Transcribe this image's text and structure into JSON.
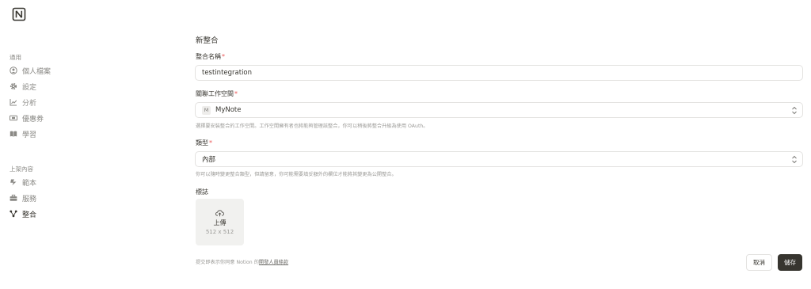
{
  "sidebar": {
    "general_title": "通用",
    "general_items": [
      {
        "label": "個人檔案",
        "icon": "user-circle-icon"
      },
      {
        "label": "設定",
        "icon": "gear-icon"
      },
      {
        "label": "分析",
        "icon": "chart-line-icon"
      },
      {
        "label": "優惠券",
        "icon": "ticket-icon"
      },
      {
        "label": "學習",
        "icon": "book-icon"
      }
    ],
    "listing_title": "上架內容",
    "listing_items": [
      {
        "label": "範本",
        "icon": "template-icon"
      },
      {
        "label": "服務",
        "icon": "briefcase-icon"
      },
      {
        "label": "整合",
        "icon": "integration-icon",
        "active": true
      }
    ]
  },
  "form": {
    "page_title": "新整合",
    "name_label": "整合名稱",
    "name_value": "testintegration",
    "workspace_label": "關聯工作空間",
    "workspace_badge": "M",
    "workspace_value": "MyNote",
    "workspace_help": "選擇要安裝整合的工作空間。工作空間擁有者也將能夠管理該整合，你可以稍後將整合升級為使用 OAuth。",
    "type_label": "類型",
    "type_value": "內部",
    "type_help": "你可以隨時變更整合類型，但請留意，你可能需要填妥額外的欄位才能將其變更為公開整合。",
    "logo_label": "標誌",
    "upload_label": "上傳",
    "upload_size": "512 x 512",
    "required_mark": "*"
  },
  "footer": {
    "terms_prefix": "提交即表示你同意 Notion 的",
    "terms_link": "開發人員條款",
    "cancel_label": "取消",
    "save_label": "儲存"
  },
  "colors": {
    "text": "#37352f",
    "muted": "#8a8985",
    "required": "#eb5757",
    "save_bg": "#37352f"
  }
}
